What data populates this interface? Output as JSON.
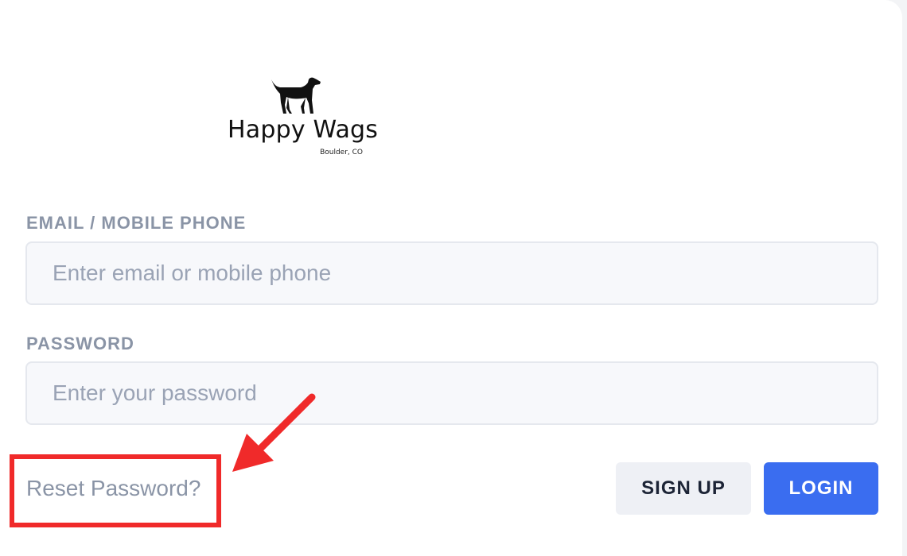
{
  "logo": {
    "name": "Happy Wags",
    "location": "Boulder, CO",
    "icon": "dog-icon"
  },
  "form": {
    "email": {
      "label": "EMAIL / MOBILE PHONE",
      "placeholder": "Enter email or mobile phone",
      "value": ""
    },
    "password": {
      "label": "PASSWORD",
      "placeholder": "Enter your password",
      "value": ""
    }
  },
  "actions": {
    "reset_label": "Reset Password?",
    "signup_label": "SIGN UP",
    "login_label": "LOGIN"
  },
  "annotation": {
    "highlight_color": "#f02a2a",
    "arrow_icon": "arrow-icon"
  },
  "colors": {
    "primary": "#3a6df0",
    "label": "#8a94a6",
    "secondary_button": "#eef0f5"
  }
}
